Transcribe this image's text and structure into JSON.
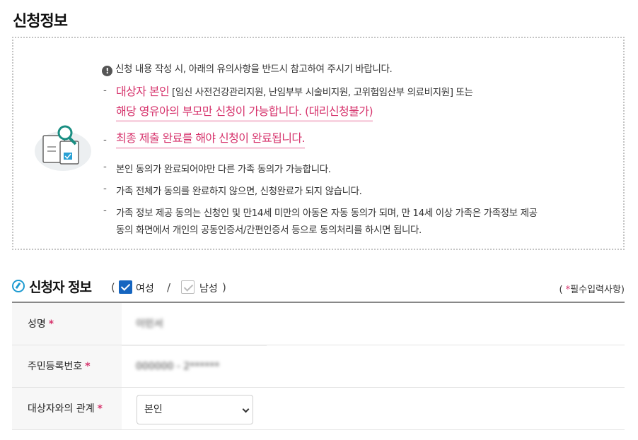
{
  "page": {
    "title": "신청정보"
  },
  "notice": {
    "info": "신청 내용 작성 시, 아래의 유의사항을 반드시 참고하여 주시기 바랍니다.",
    "info_icon": "exclamation-icon",
    "dash": "-",
    "b1_pink": "대상자 본인",
    "b1_rest": "[임신 사전건강관리지원, 난임부부 시술비지원, 고위험임산부 의료비지원] 또는",
    "b1_line2": "해당 영유아의 부모만 신청이 가능합니다. (대리신청불가)",
    "b2": "최종 제출 완료를 해야 신청이 완료됩니다.",
    "b3": "본인 동의가 완료되어야만 다른 가족 동의가 가능합니다.",
    "b4": "가족 전체가 동의를 완료하지 않으면, 신청완료가 되지 않습니다.",
    "b5_line1": "가족 정보 제공 동의는 신청인 및 만14세 미만의 아동은 자동 동의가 되며, 만 14세 이상 가족은 가족정보 제공",
    "b5_line2": "동의 화면에서 개인의 공동인증서/간편인증서 등으로 동의처리를 하시면 됩니다."
  },
  "applicant": {
    "title": "신청자 정보",
    "paren_open": "(",
    "paren_close": ")",
    "slash": "/",
    "female_label": "여성",
    "female_checked": true,
    "male_label": "남성",
    "male_checked": false,
    "required_open": "(",
    "required_star": "*",
    "required_text": "필수입력사항",
    "required_close": ")"
  },
  "form": {
    "star": "*",
    "name_label": "성명",
    "name_value": "이민서",
    "rrn_label": "주민등록번호",
    "rrn_value": "000000 - 2******",
    "relation_label": "대상자와의 관계",
    "relation_value": "본인"
  },
  "colors": {
    "accent_pink": "#d6336c",
    "checkbox_blue": "#1565c0",
    "edit_icon_blue": "#1e9bd1"
  }
}
